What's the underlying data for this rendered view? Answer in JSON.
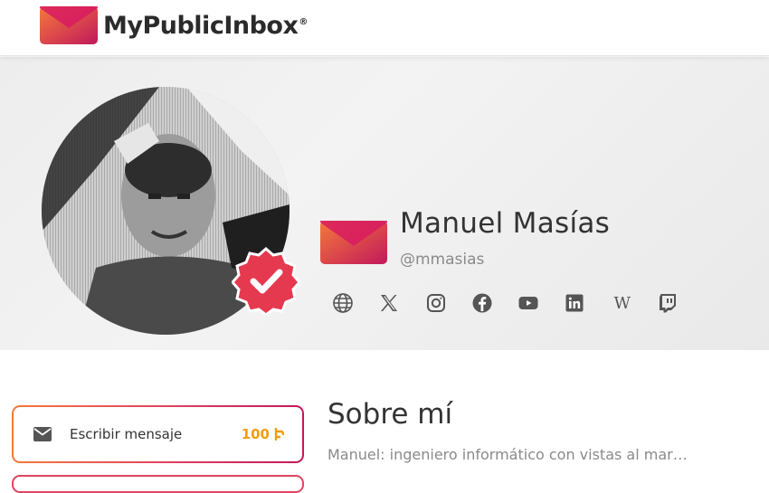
{
  "header": {
    "logo_text": "MyPublicInbox",
    "logo_reg": "®"
  },
  "profile": {
    "name": "Manuel Masías",
    "handle": "@mmasias",
    "verified": true,
    "social_links": [
      {
        "icon": "globe-icon"
      },
      {
        "icon": "x-twitter-icon"
      },
      {
        "icon": "instagram-icon"
      },
      {
        "icon": "facebook-icon"
      },
      {
        "icon": "youtube-icon"
      },
      {
        "icon": "linkedin-icon"
      },
      {
        "icon": "wikipedia-icon",
        "glyph": "W"
      },
      {
        "icon": "twitch-icon"
      }
    ]
  },
  "actions": {
    "write_message_label": "Escribir mensaje",
    "price": "100"
  },
  "about": {
    "title": "Sobre mí",
    "text": "Manuel: ingeniero informático con vistas al mar…"
  },
  "colors": {
    "brand_start": "#f47a3a",
    "brand_end": "#c2185b",
    "verified_red": "#e53950",
    "price_orange": "#f39c12"
  }
}
